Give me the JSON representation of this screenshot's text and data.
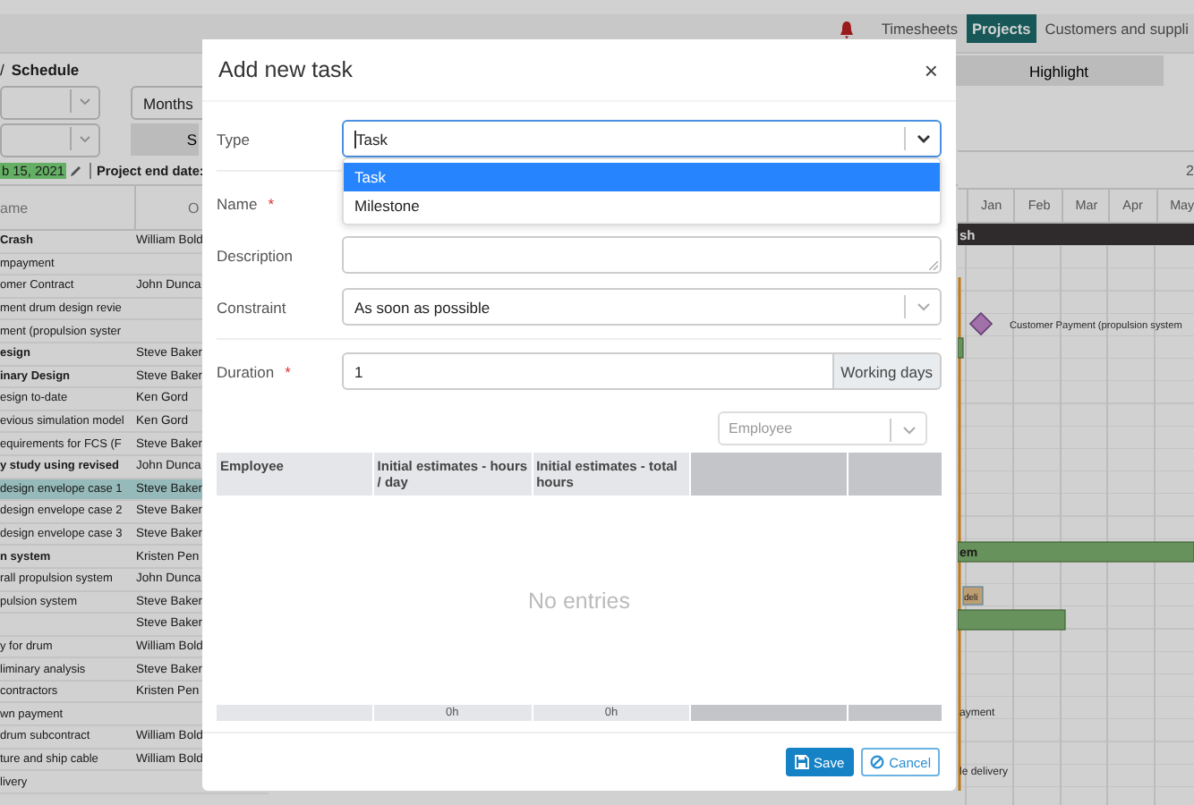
{
  "top_nav": {
    "items": [
      {
        "label": "Timesheets",
        "selected": false
      },
      {
        "label": "Projects",
        "selected": true
      },
      {
        "label": "Customers and suppli",
        "selected": false
      }
    ]
  },
  "breadcrumb": {
    "separator": "/",
    "current": "Schedule"
  },
  "toolbar": {
    "zoom_select": "Months",
    "button_partial": "S",
    "highlight_button": "Highlight"
  },
  "project_dates": {
    "start": "b 15, 2021",
    "end_label": "Project end date:"
  },
  "task_table": {
    "columns": [
      "ame",
      "O"
    ],
    "rows": [
      {
        "name": "Crash",
        "owner": "William Bold",
        "bold": true,
        "selected": false
      },
      {
        "name": "mpayment",
        "owner": "",
        "bold": false,
        "selected": false
      },
      {
        "name": "omer Contract",
        "owner": "John Dunca",
        "bold": false,
        "selected": false
      },
      {
        "name": "ment drum design revie",
        "owner": "",
        "bold": false,
        "selected": false
      },
      {
        "name": "ment (propulsion syster",
        "owner": "",
        "bold": false,
        "selected": false
      },
      {
        "name": "esign",
        "owner": "Steve Baker",
        "bold": true,
        "selected": false
      },
      {
        "name": "inary Design",
        "owner": "Steve Baker",
        "bold": true,
        "selected": false
      },
      {
        "name": "esign to-date",
        "owner": "Ken Gord",
        "bold": false,
        "selected": false
      },
      {
        "name": "evious simulation model",
        "owner": "Ken Gord",
        "bold": false,
        "selected": false
      },
      {
        "name": "equirements for FCS (F",
        "owner": "Steve Baker",
        "bold": false,
        "selected": false
      },
      {
        "name": "y study using revised",
        "owner": "John Dunca",
        "bold": true,
        "selected": false
      },
      {
        "name": "design envelope case 1",
        "owner": "Steve Baker",
        "bold": false,
        "selected": true
      },
      {
        "name": "design envelope case 2",
        "owner": "Steve Baker",
        "bold": false,
        "selected": false
      },
      {
        "name": "design envelope case 3",
        "owner": "Steve Baker",
        "bold": false,
        "selected": false
      },
      {
        "name": "n system",
        "owner": "Kristen Pen",
        "bold": true,
        "selected": false
      },
      {
        "name": "rall propulsion system",
        "owner": "John Dunca",
        "bold": false,
        "selected": false
      },
      {
        "name": "pulsion system",
        "owner": "Steve Baker",
        "bold": false,
        "selected": false
      },
      {
        "name": "",
        "owner": "Steve Baker",
        "selected": false
      },
      {
        "name": "y for drum",
        "owner": "William Bold",
        "bold": false,
        "selected": false
      },
      {
        "name": "liminary analysis",
        "owner": "Steve Baker",
        "bold": false,
        "selected": false
      },
      {
        "name": "contractors",
        "owner": "Kristen Pen",
        "bold": false,
        "selected": false
      },
      {
        "name": "wn payment",
        "owner": "",
        "bold": false,
        "selected": false
      },
      {
        "name": "drum subcontract",
        "owner": "William Bold",
        "bold": false,
        "selected": false
      },
      {
        "name": "ture and ship cable",
        "owner": "William Bold",
        "bold": false,
        "selected": false
      },
      {
        "name": "livery",
        "owner": "",
        "bold": false,
        "selected": false
      }
    ]
  },
  "gantt": {
    "year": "2",
    "months": [
      "Jan",
      "Feb",
      "Mar",
      "Apr",
      "May"
    ],
    "summary_bar_label": "sh",
    "milestone_label": "Customer Payment (propulsion system",
    "green_bar_label": "em",
    "small_box_label": "deli",
    "label_payment": "ayment",
    "label_delivery": "le delivery"
  },
  "dialog": {
    "title": "Add new task",
    "close": "×",
    "type": {
      "label": "Type",
      "value": "Task",
      "open": true,
      "options": [
        {
          "label": "Task",
          "selected": true
        },
        {
          "label": "Milestone",
          "selected": false
        }
      ]
    },
    "name": {
      "label": "Name",
      "required_mark": "*"
    },
    "description": {
      "label": "Description"
    },
    "constraint": {
      "label": "Constraint",
      "value": "As soon as possible"
    },
    "duration": {
      "label": "Duration",
      "required_mark": "*",
      "value": "1",
      "unit": "Working days"
    },
    "employee_select": {
      "placeholder": "Employee"
    },
    "table": {
      "columns": [
        "Employee",
        "Initial estimates - hours / day",
        "Initial estimates - total hours"
      ],
      "empty_text": "No entries",
      "totals": [
        "0h",
        "0h"
      ]
    },
    "buttons": {
      "save": "Save",
      "cancel": "Cancel"
    }
  }
}
